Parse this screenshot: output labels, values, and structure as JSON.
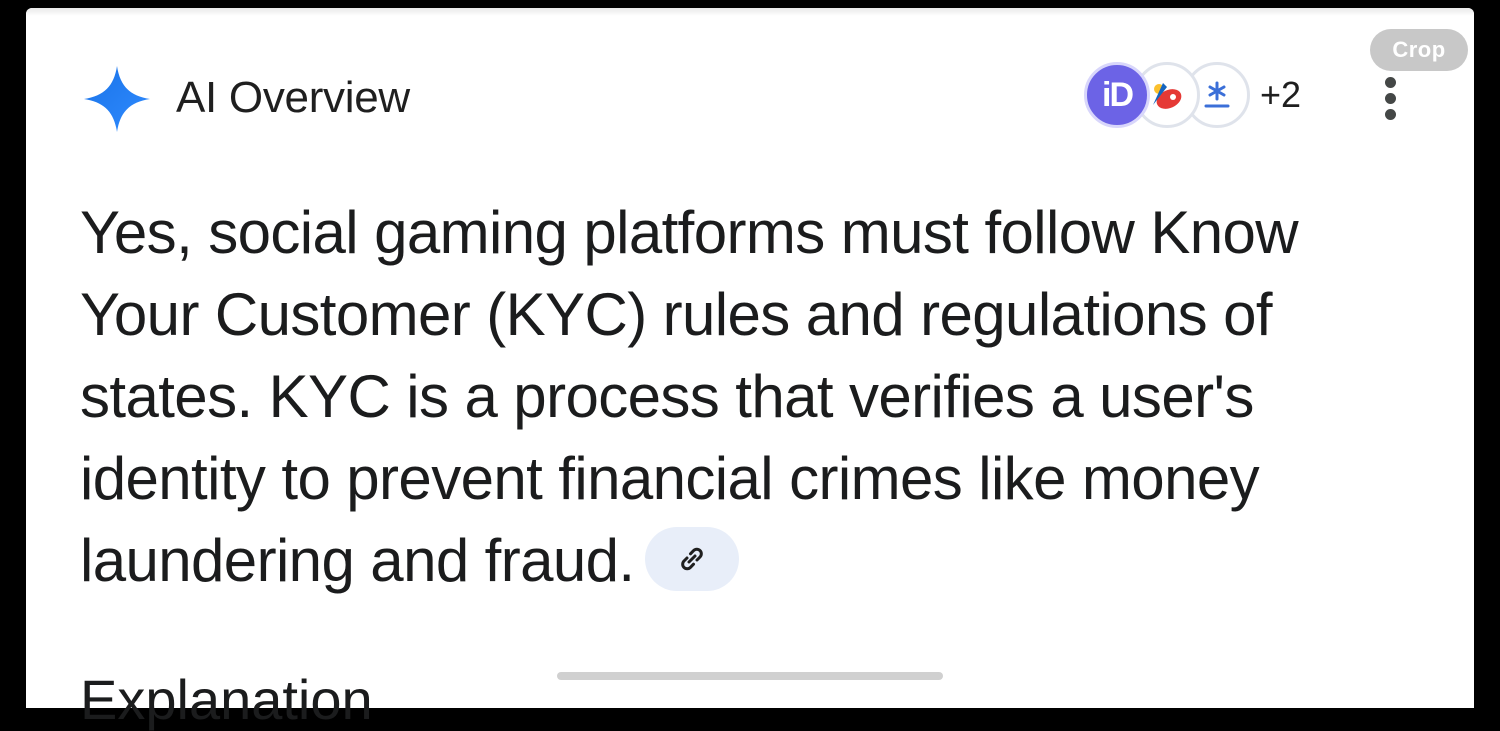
{
  "crop_label": "Crop",
  "overview": {
    "title": "AI Overview",
    "sources_more": "+2",
    "source_icons": [
      "id-logo-icon",
      "brand-logo-icon",
      "asterisk-logo-icon"
    ],
    "accent_color": "#1a73e8",
    "answer": "Yes, social gaming platforms must follow Know Your Customer (KYC) rules and regulations of states. KYC is a process that verifies a user's identity to prevent financial crimes like money laundering and fraud.",
    "next_heading": "Explanation"
  }
}
